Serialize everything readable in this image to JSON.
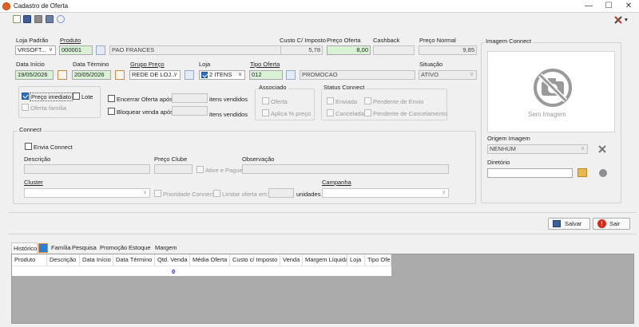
{
  "window": {
    "title": "Cadastro de Oferta",
    "minimize": "—",
    "maximize": "☐",
    "close": "✕"
  },
  "toolbar": {
    "tools_arrow": "▾"
  },
  "form": {
    "loja_padrao": {
      "label": "Loja Padrão",
      "value": "VRSOFT..."
    },
    "produto": {
      "label": "Produto",
      "code": "000001",
      "name": "PAO FRANCES"
    },
    "custo_imposto": {
      "label": "Custo C/ Imposto",
      "value": "5,78"
    },
    "preco_oferta": {
      "label": "Preço Oferta",
      "value": "8,00"
    },
    "cashback": {
      "label": "Cashback",
      "value": ""
    },
    "preco_normal": {
      "label": "Preço Normal",
      "value": "9,85"
    },
    "data_inicio": {
      "label": "Data Início",
      "value": "19/05/2026"
    },
    "data_termino": {
      "label": "Data Término",
      "value": "20/05/2026"
    },
    "grupo_preco": {
      "label": "Grupo Preço",
      "value": "REDE DE LOJ..."
    },
    "loja": {
      "label": "Loja",
      "value": "2 ITENS"
    },
    "tipo_oferta": {
      "label": "Tipo Oferta",
      "code": "012",
      "name": "PROMOCAO"
    },
    "situacao": {
      "label": "Situação",
      "value": "ATIVO"
    },
    "preco_imediato": "Preço imediato",
    "lote": "Lote",
    "oferta_familia": "Oferta família",
    "encerrar_oferta": "Encerrar Oferta após",
    "bloquear_venda": "Bloquear venda após",
    "itens_vendidos_1": "itens vendidos",
    "itens_vendidos_2": "itens vendidos",
    "associado": {
      "title": "Associado",
      "oferta": "Oferta",
      "aplica": "Aplica % preço"
    },
    "status_connect": {
      "title": "Status Connect",
      "enviada": "Enviada",
      "cancelada": "Cancelada",
      "pendente_envio": "Pendente de Envio",
      "pendente_cancelamento": "Pendente de Cancelamento"
    },
    "connect": {
      "title": "Connect",
      "envia_connect": "Envia Connect",
      "descricao": "Descrição",
      "preco_clube": "Preço Clube",
      "ative_pague": "Ative e Pague",
      "observacao": "Observação",
      "cluster": "Cluster",
      "prioridade": "Prioridade Connect",
      "limitar": "Limitar oferta em:",
      "unidades": "unidades",
      "campanha": "Campanha"
    }
  },
  "imagem": {
    "title": "Imagem Connect",
    "placeholder": "Sem Imagem",
    "origem_label": "Origem Imagem",
    "origem_value": "NENHUM",
    "diretorio_label": "Diretório"
  },
  "actions": {
    "salvar": "Salvar",
    "sair": "Sair"
  },
  "tabs": [
    "Histórico",
    "Família",
    "Pesquisa",
    "Promoção",
    "Estoque",
    "Margem"
  ],
  "grid": {
    "columns": [
      "Produto",
      "Descrição",
      "Data Início",
      "Data Término",
      "Qtd. Venda",
      "Média Oferta",
      "Custo c/ Imposto",
      "Venda",
      "Margem Líquida",
      "Loja",
      "Tipo Oferta"
    ],
    "total_qtd": "0"
  },
  "colors": {
    "accent": "#2b70c9",
    "highlight_green": "#d9f2d6",
    "total_blue": "#1a1aa0"
  }
}
